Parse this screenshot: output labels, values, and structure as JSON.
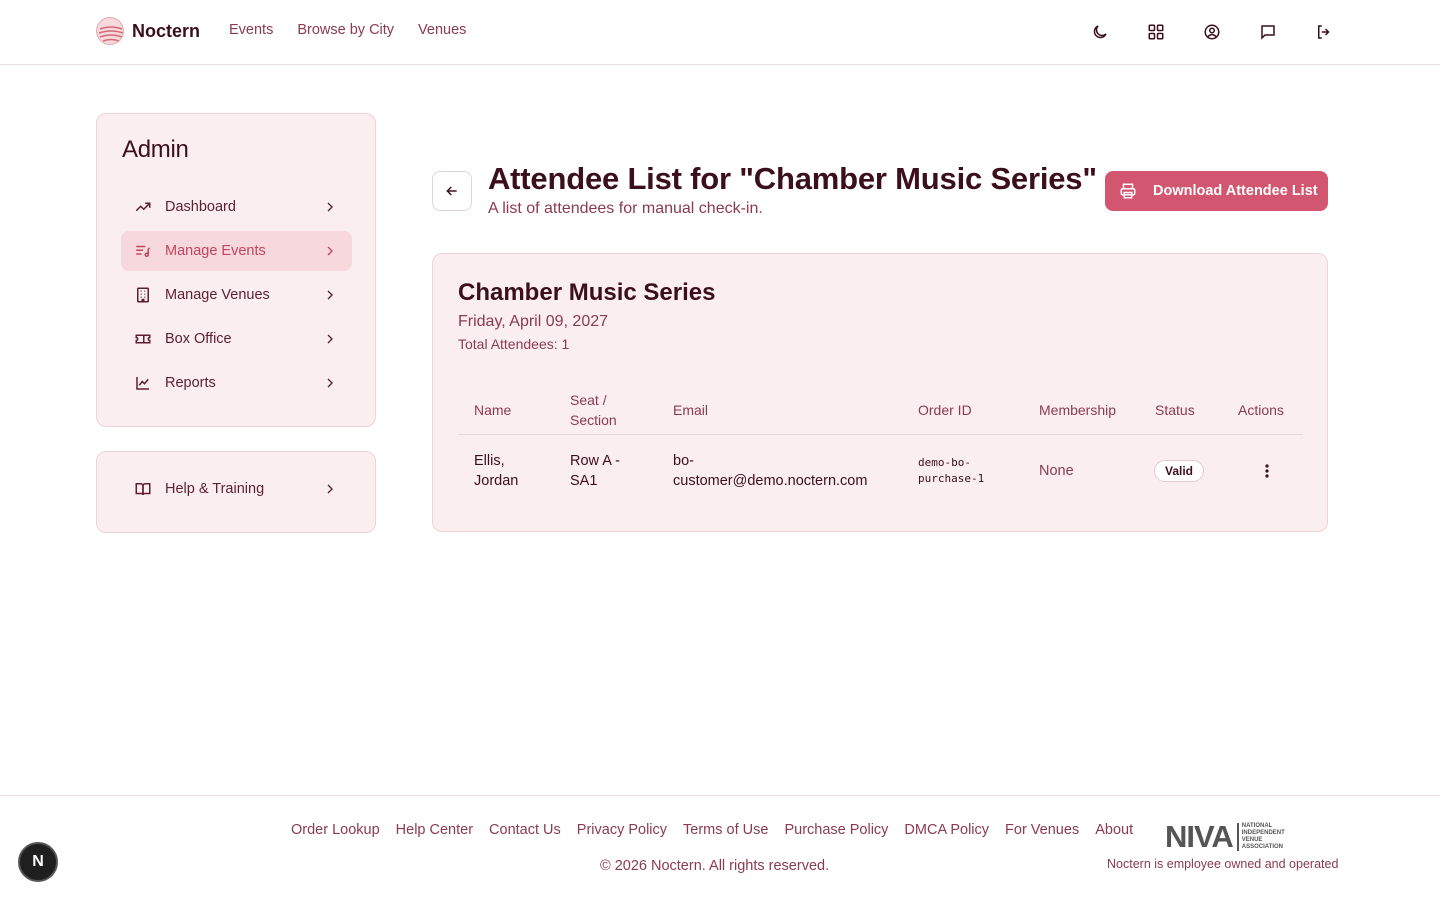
{
  "brand": {
    "name": "Noctern"
  },
  "nav": {
    "events": "Events",
    "browse": "Browse by City",
    "venues": "Venues"
  },
  "header_icons": [
    "moon-icon",
    "qr-grid-icon",
    "user-circle-icon",
    "message-icon",
    "logout-icon"
  ],
  "sidebar": {
    "title": "Admin",
    "items": [
      {
        "label": "Dashboard",
        "icon": "trending-up-icon"
      },
      {
        "label": "Manage Events",
        "icon": "music-list-icon",
        "active": true
      },
      {
        "label": "Manage Venues",
        "icon": "building-icon"
      },
      {
        "label": "Box Office",
        "icon": "ticket-icon"
      },
      {
        "label": "Reports",
        "icon": "line-chart-icon"
      }
    ],
    "help": {
      "label": "Help & Training",
      "icon": "book-icon"
    }
  },
  "page": {
    "title": "Attendee List for \"Chamber Music Series\"",
    "subtitle": "A list of attendees for manual check-in.",
    "download_label": "Download Attendee List"
  },
  "event": {
    "name": "Chamber Music Series",
    "date": "Friday, April 09, 2027",
    "total": "Total Attendees: 1"
  },
  "table": {
    "headers": {
      "name": "Name",
      "seat_line1": "Seat /",
      "seat_line2": "Section",
      "email": "Email",
      "order": "Order ID",
      "membership": "Membership",
      "status": "Status",
      "actions": "Actions"
    },
    "rows": [
      {
        "name_line1": "Ellis,",
        "name_line2": "Jordan",
        "seat_line1": "Row A -",
        "seat_line2": "SA1",
        "email_line1": "bo-",
        "email_line2": "customer@demo.noctern.com",
        "order_line1": "demo-bo-",
        "order_line2": "purchase-1",
        "membership": "None",
        "status": "Valid"
      }
    ]
  },
  "footer": {
    "links": [
      "Order Lookup",
      "Help Center",
      "Contact Us",
      "Privacy Policy",
      "Terms of Use",
      "Purchase Policy",
      "DMCA Policy",
      "For Venues",
      "About"
    ],
    "copyright": "© 2026 Noctern. All rights reserved.",
    "niva_big": "NIVA",
    "niva_small_1": "NATIONAL",
    "niva_small_2": "INDEPENDENT",
    "niva_small_3": "VENUE",
    "niva_small_4": "ASSOCIATION",
    "employee_owned": "Noctern is employee owned and operated"
  },
  "fab_label": "N",
  "colors": {
    "accent": "#d2566f",
    "card_bg": "#fbeef0",
    "text_dark": "#3b0f1c",
    "text_muted": "#8a3b50"
  }
}
